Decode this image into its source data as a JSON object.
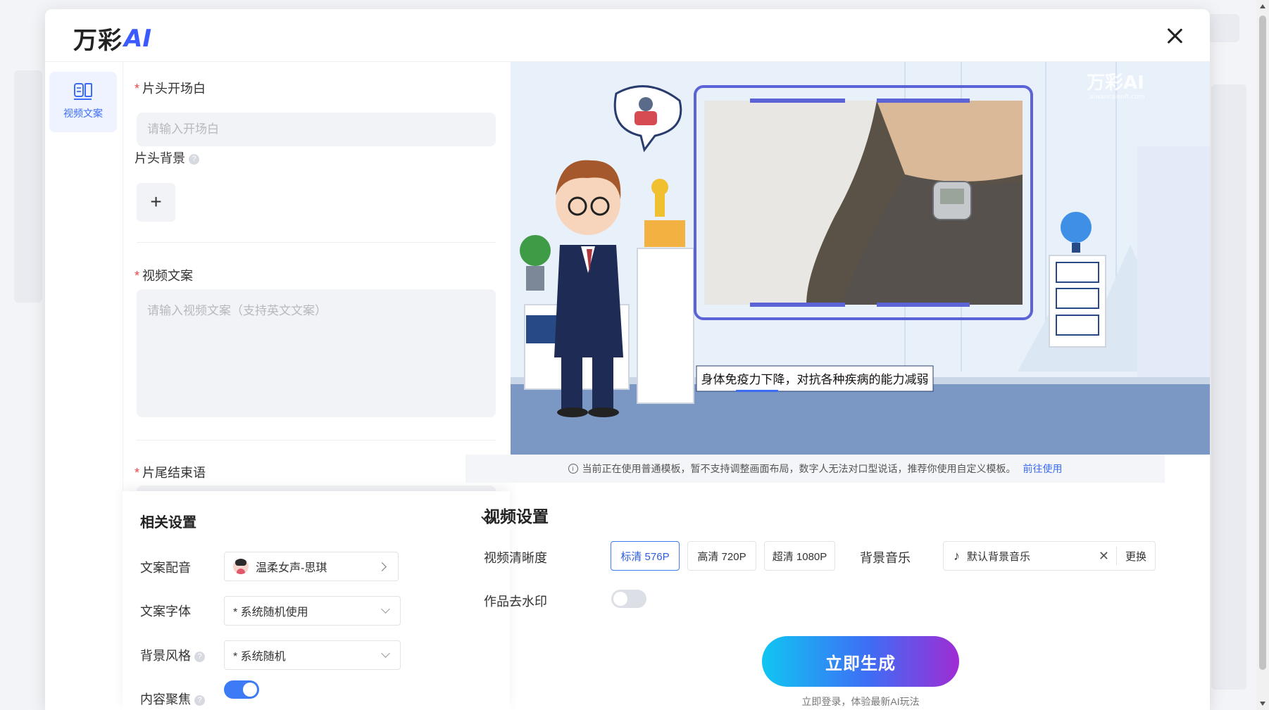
{
  "brand": {
    "logo_cn": "万彩",
    "logo_ai": "AI"
  },
  "sidebar": {
    "items": [
      {
        "label": "视频文案",
        "icon": "mic-script-icon"
      }
    ]
  },
  "form": {
    "opening_label": "片头开场白",
    "opening_placeholder": "请输入开场白",
    "bg_label": "片头背景",
    "bg_add": "+",
    "script_label": "视频文案",
    "script_placeholder": "请输入视频文案（支持英文文案）",
    "ending_label": "片尾结束语"
  },
  "settings": {
    "title": "相关设置",
    "voice_label": "文案配音",
    "voice_value": "温柔女声-思琪",
    "font_label": "文案字体",
    "font_value": "* 系统随机使用",
    "style_label": "背景风格",
    "style_value": "* 系统随机",
    "focus_label": "内容聚焦",
    "focus_on": true
  },
  "preview": {
    "watermark": "万彩AI",
    "watermark_sub": "aiwancaisoft.com",
    "subtitle": "身体免疫力下降，对抗各种疾病的能力减弱"
  },
  "notice": {
    "text": "当前正在使用普通模板，暂不支持调整画面布局，数字人无法对口型说话，推荐你使用自定义模板。",
    "link": "前往使用"
  },
  "video_settings": {
    "title": "视频设置",
    "quality_label": "视频清晰度",
    "qualities": [
      "标清 576P",
      "高清 720P",
      "超清 1080P"
    ],
    "quality_selected": "标清 576P",
    "music_label": "背景音乐",
    "music_value": "默认背景音乐",
    "music_change": "更换",
    "watermark_label": "作品去水印",
    "watermark_removed": false,
    "generate": "立即生成",
    "generate_sub": "立即登录，体验最新AI玩法"
  },
  "colors": {
    "accent": "#3d7bf6",
    "required": "#f04646"
  }
}
